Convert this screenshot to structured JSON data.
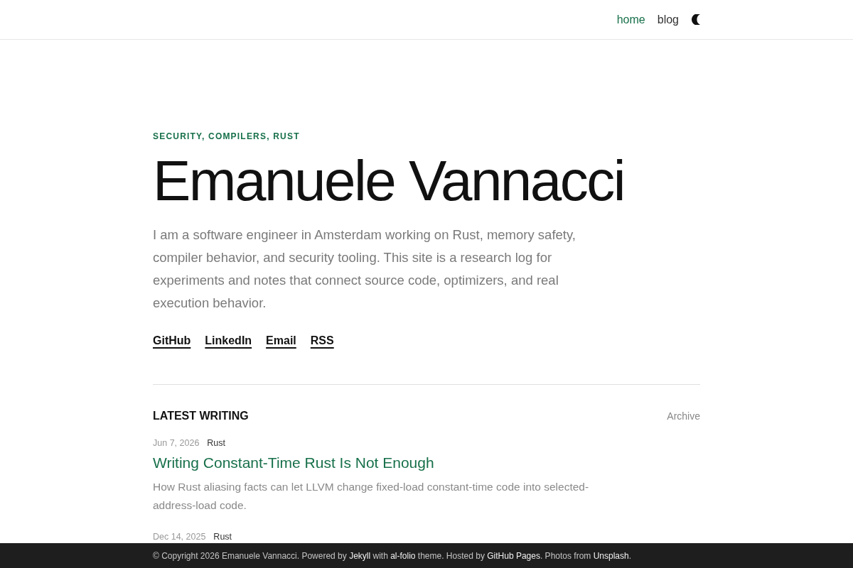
{
  "nav": {
    "items": [
      {
        "label": "home",
        "selected": true
      },
      {
        "label": "blog",
        "selected": false
      }
    ]
  },
  "hero": {
    "kicker": "SECURITY, COMPILERS, RUST",
    "title": "Emanuele Vannacci",
    "intro": "I am a software engineer in Amsterdam working on Rust, memory safety, compiler behavior, and security tooling. This site is a research log for experiments and notes that connect source code, optimizers, and real execution behavior.",
    "links": [
      "GitHub",
      "LinkedIn",
      "Email",
      "RSS"
    ]
  },
  "latest": {
    "heading": "LATEST WRITING",
    "archive_link": "Archive",
    "posts": [
      {
        "date": "Jun 7, 2026",
        "tag": "Rust",
        "title": "Writing Constant-Time Rust Is Not Enough",
        "excerpt": "How Rust aliasing facts can let LLVM change fixed-load constant-time code into selected-address-load code."
      },
      {
        "date": "Dec 14, 2025",
        "tag": "Rust"
      }
    ]
  },
  "footer": {
    "parts": [
      {
        "kind": "text",
        "text": "© Copyright 2026 Emanuele Vannacci. Powered by "
      },
      {
        "kind": "link",
        "text": "Jekyll"
      },
      {
        "kind": "text",
        "text": " with "
      },
      {
        "kind": "link",
        "text": "al-folio"
      },
      {
        "kind": "text",
        "text": " theme. Hosted by "
      },
      {
        "kind": "link",
        "text": "GitHub Pages"
      },
      {
        "kind": "text",
        "text": ". Photos from "
      },
      {
        "kind": "link",
        "text": "Unsplash"
      },
      {
        "kind": "text",
        "text": "."
      }
    ]
  }
}
